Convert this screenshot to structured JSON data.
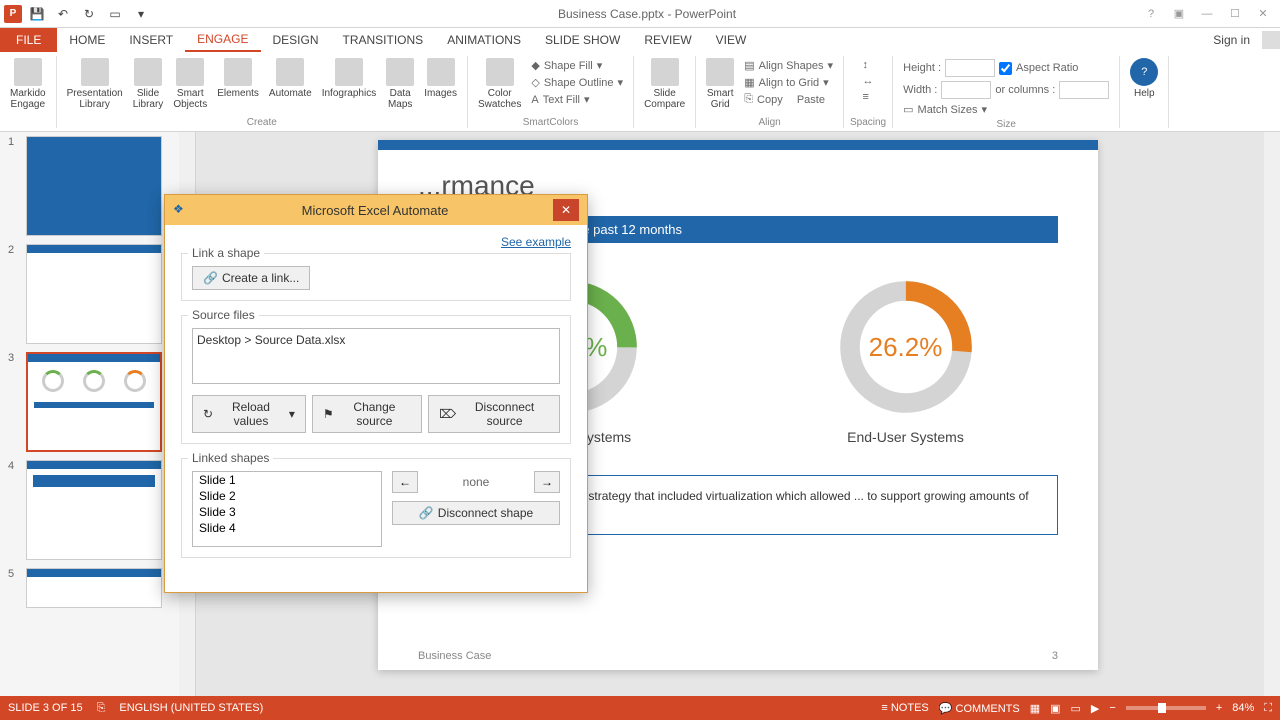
{
  "titlebar": {
    "title": "Business Case.pptx - PowerPoint"
  },
  "tabs": {
    "file": "FILE",
    "items": [
      "HOME",
      "INSERT",
      "ENGAGE",
      "DESIGN",
      "TRANSITIONS",
      "ANIMATIONS",
      "SLIDE SHOW",
      "REVIEW",
      "VIEW"
    ],
    "active_index": 2,
    "signin": "Sign in"
  },
  "ribbon": {
    "engage_btns": [
      "Markido\nEngage",
      "Presentation\nLibrary",
      "Slide\nLibrary",
      "Smart\nObjects",
      "Elements",
      "Automate",
      "Infographics",
      "Data\nMaps",
      "Images",
      "Color\nSwatches"
    ],
    "create_group": "Create",
    "shape_btns": [
      "Shape Fill",
      "Shape Outline",
      "Text Fill"
    ],
    "smartcolors_group": "SmartColors",
    "compare_btn": "Slide\nCompare",
    "grid_btn": "Smart\nGrid",
    "align_btns": [
      "Align Shapes",
      "Align to Grid",
      "Copy",
      "Paste"
    ],
    "align_group": "Align",
    "spacing_group": "Spacing",
    "size_labels": {
      "height": "Height :",
      "width": "Width :",
      "or": "or columns :",
      "aspect": "Aspect Ratio",
      "match": "Match Sizes"
    },
    "size_group": "Size",
    "help_btn": "Help"
  },
  "thumbs": {
    "count": 5,
    "selected": 3,
    "labels": [
      "1",
      "2",
      "3",
      "4",
      "5"
    ]
  },
  "slide": {
    "title": "...rmance",
    "subtitle": "System availability over the past 12 months",
    "footer_left": "Business Case",
    "footer_right": "3",
    "note": "...e implemented a scalability strategy that included virtualization which allowed ... to support growing amounts of work using less IT resources."
  },
  "chart_data": {
    "type": "pie",
    "series": [
      {
        "name": "Enterprise Systems",
        "value": 25.2,
        "display": "25.2%",
        "color": "#6ab04c"
      },
      {
        "name": "End-User Systems",
        "value": 26.2,
        "display": "26.2%",
        "color": "#e67e22"
      }
    ]
  },
  "dialog": {
    "title": "Microsoft Excel Automate",
    "see_example": "See example",
    "link_shape_label": "Link a shape",
    "create_link": "Create a link...",
    "source_label": "Source files",
    "source_text": "Desktop > Source Data.xlsx",
    "reload": "Reload values",
    "change": "Change source",
    "disconnect_src": "Disconnect source",
    "linked_label": "Linked shapes",
    "slides": [
      "Slide 1",
      "Slide 2",
      "Slide 3",
      "Slide 4"
    ],
    "none": "none",
    "disconnect_shape": "Disconnect shape"
  },
  "status": {
    "slide": "SLIDE 3 OF 15",
    "lang": "ENGLISH (UNITED STATES)",
    "notes": "NOTES",
    "comments": "COMMENTS",
    "zoom": "84%"
  }
}
